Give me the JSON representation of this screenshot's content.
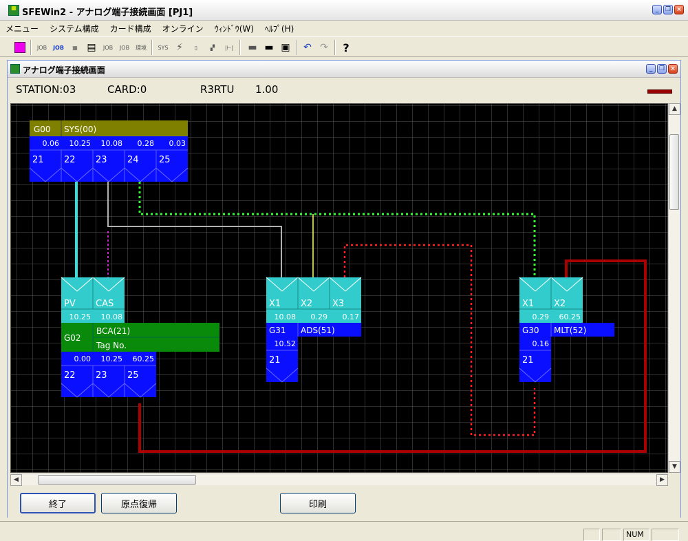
{
  "window": {
    "title": "SFEWin2 - アナログ端子接続画面 [PJ1]",
    "icon": "sfewin-app-icon"
  },
  "menu": [
    "メニュー",
    "システム構成",
    "カード構成",
    "オンライン",
    "ｳｨﾝﾄﾞｳ(W)",
    "ﾍﾙﾌﾟ(H)"
  ],
  "child_window": {
    "title": "アナログ端子接続画面"
  },
  "info": {
    "station": "STATION:03",
    "card": "CARD:0",
    "model": "R3RTU",
    "version": "1.00"
  },
  "blocks": {
    "g00": {
      "group": "G00",
      "name": "SYS(00)",
      "values": [
        "0.06",
        "10.25",
        "10.08",
        "0.28",
        "0.03"
      ],
      "terminals": [
        "21",
        "22",
        "23",
        "24",
        "25"
      ]
    },
    "g02": {
      "inputs": [
        "PV",
        "CAS"
      ],
      "input_values": [
        "10.25",
        "10.08"
      ],
      "group": "G02",
      "name": "BCA(21)",
      "tag": "Tag No.",
      "values": [
        "0.00",
        "10.25",
        "60.25"
      ],
      "terminals": [
        "22",
        "23",
        "25"
      ]
    },
    "g31": {
      "inputs": [
        "X1",
        "X2",
        "X3"
      ],
      "input_values": [
        "10.08",
        "0.29",
        "0.17"
      ],
      "group": "G31",
      "name": "ADS(51)",
      "values": [
        "10.52"
      ],
      "terminals": [
        "21"
      ]
    },
    "g30": {
      "inputs": [
        "X1",
        "X2"
      ],
      "input_values": [
        "0.29",
        "60.25"
      ],
      "group": "G30",
      "name": "MLT(52)",
      "values": [
        "0.16"
      ],
      "terminals": [
        "21"
      ]
    }
  },
  "buttons": {
    "exit": "終了",
    "reset_origin": "原点復帰",
    "print": "印刷"
  },
  "status": {
    "num": "NUM"
  },
  "colors": {
    "grid_line": "#5a5a5a",
    "block_blue": "#0a10ff",
    "block_cyan": "#33cccc",
    "header_olive": "#808000",
    "header_green": "#0a8a0a",
    "wire_cyan": "#33e0e0",
    "wire_gray": "#b0b0b0",
    "wire_magenta": "#ff33ff",
    "wire_yellow": "#ffff66",
    "wire_green_dotted": "#33ff33",
    "wire_red_dotted": "#ff2222",
    "wire_darkred": "#aa0000"
  }
}
